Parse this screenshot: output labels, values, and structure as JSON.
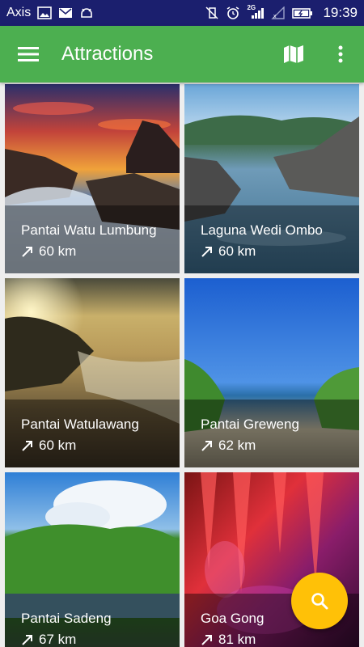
{
  "status_bar": {
    "carrier": "Axis",
    "clock": "19:39",
    "network_type": "2G",
    "colors": {
      "background": "#1b1f6e",
      "text": "#ffffff"
    },
    "left_icons": [
      "image-icon",
      "mail-icon",
      "android-debug-icon"
    ],
    "right_icons": [
      "vibrate-off-icon",
      "alarm-icon",
      "signal-icon",
      "no-signal-icon",
      "battery-icon"
    ]
  },
  "app_bar": {
    "title": "Attractions",
    "menu_icon": "hamburger-menu-icon",
    "actions": [
      "map-icon",
      "more-vert-icon"
    ],
    "color": "#4caf50"
  },
  "attractions": [
    {
      "name": "Pantai Watu Lumbung",
      "distance": "60 km",
      "theme": "sunset-rocks"
    },
    {
      "name": "Laguna Wedi Ombo",
      "distance": "60 km",
      "theme": "lagoon"
    },
    {
      "name": "Pantai Watulawang",
      "distance": "60 km",
      "theme": "golden-cliff"
    },
    {
      "name": "Pantai Greweng",
      "distance": "62 km",
      "theme": "blue-bay"
    },
    {
      "name": "Pantai Sadeng",
      "distance": "67 km",
      "theme": "green-hill"
    },
    {
      "name": "Goa Gong",
      "distance": "81 km",
      "theme": "red-cave"
    }
  ],
  "fab": {
    "icon": "search-icon",
    "color": "#ffc107"
  }
}
